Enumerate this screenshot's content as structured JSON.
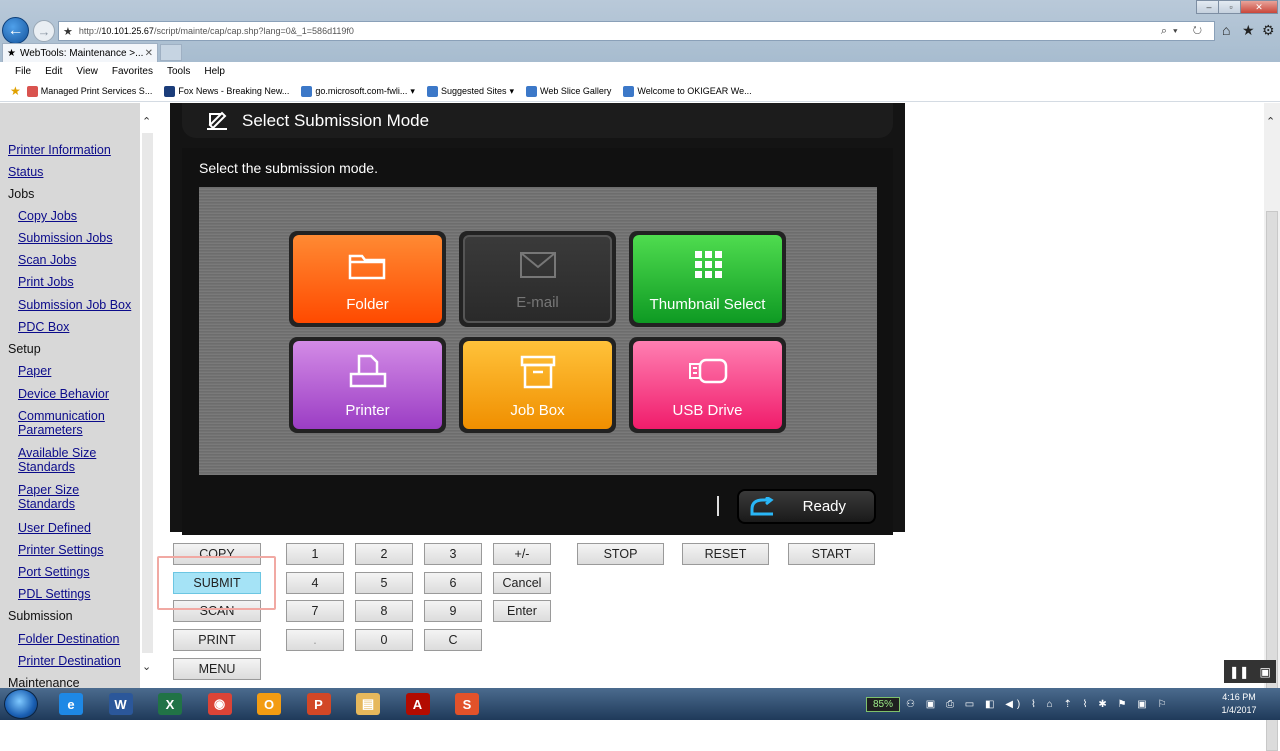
{
  "browser": {
    "url_prefix": "http://",
    "url_host": "10.101.25.67",
    "url_path": "/script/mainte/cap/cap.shp?lang=0&_1=586d119f0",
    "tab_title": "WebTools: Maintenance >...",
    "window_controls": [
      "–",
      "▫",
      "✕"
    ],
    "menu": [
      "File",
      "Edit",
      "View",
      "Favorites",
      "Tools",
      "Help"
    ],
    "favorites": [
      {
        "label": "Managed Print Services S...",
        "color": "#d9534f"
      },
      {
        "label": "Fox News - Breaking New...",
        "color": "#1b3d7a"
      },
      {
        "label": "go.microsoft.com-fwli...",
        "color": "#3c78c8"
      },
      {
        "label": "Suggested Sites",
        "color": "#3c78c8"
      },
      {
        "label": "Web Slice Gallery",
        "color": "#3c78c8"
      },
      {
        "label": "Welcome to OKIGEAR We...",
        "color": "#3c78c8"
      }
    ]
  },
  "nav": {
    "items": [
      {
        "label": "Printer Information",
        "type": "link",
        "indent": false
      },
      {
        "label": "Status",
        "type": "link",
        "indent": false
      },
      {
        "label": "Jobs",
        "type": "hdr",
        "indent": false
      },
      {
        "label": "Copy Jobs",
        "type": "link",
        "indent": true
      },
      {
        "label": "Submission Jobs",
        "type": "link",
        "indent": true
      },
      {
        "label": "Scan Jobs",
        "type": "link",
        "indent": true
      },
      {
        "label": "Print Jobs",
        "type": "link",
        "indent": true
      },
      {
        "label": "Submission Job Box",
        "type": "link",
        "indent": true
      },
      {
        "label": "PDC Box",
        "type": "link",
        "indent": true
      },
      {
        "label": "Setup",
        "type": "hdr",
        "indent": false
      },
      {
        "label": "Paper",
        "type": "link",
        "indent": true
      },
      {
        "label": "Device Behavior",
        "type": "link",
        "indent": true
      },
      {
        "label": "Communication Parameters",
        "type": "link",
        "indent": true
      },
      {
        "label": "Available Size Standards",
        "type": "link",
        "indent": true
      },
      {
        "label": "Paper Size Standards",
        "type": "link",
        "indent": true
      },
      {
        "label": "User Defined",
        "type": "link",
        "indent": true
      },
      {
        "label": "Printer Settings",
        "type": "link",
        "indent": true
      },
      {
        "label": "Port Settings",
        "type": "link",
        "indent": true
      },
      {
        "label": "PDL Settings",
        "type": "link",
        "indent": true
      },
      {
        "label": "Submission",
        "type": "hdr",
        "indent": false
      },
      {
        "label": "Folder Destination",
        "type": "link",
        "indent": true
      },
      {
        "label": "Printer Destination",
        "type": "link",
        "indent": true
      },
      {
        "label": "Maintenance",
        "type": "hdr",
        "indent": false
      }
    ]
  },
  "panel": {
    "title": "Select Submission Mode",
    "prompt": "Select the submission mode.",
    "tiles": [
      {
        "label": "Folder",
        "icon": "folder-icon",
        "colors": [
          "#ff8a33",
          "#ff4a00"
        ],
        "disabled": false
      },
      {
        "label": "E-mail",
        "icon": "envelope-icon",
        "colors": [
          "#3a3a3a",
          "#2a2a2a"
        ],
        "disabled": true
      },
      {
        "label": "Thumbnail Select",
        "icon": "grid-icon",
        "colors": [
          "#4fdc4f",
          "#0e9a23"
        ],
        "disabled": false
      },
      {
        "label": "Printer",
        "icon": "printer-icon",
        "colors": [
          "#d38be6",
          "#9b3dc4"
        ],
        "disabled": false
      },
      {
        "label": "Job Box",
        "icon": "archive-box-icon",
        "colors": [
          "#ffc23a",
          "#f08f00"
        ],
        "disabled": false
      },
      {
        "label": "USB Drive",
        "icon": "usb-drive-icon",
        "colors": [
          "#ff7fb2",
          "#f01c6b"
        ],
        "disabled": false
      }
    ],
    "status": "Ready"
  },
  "keys": {
    "mode": [
      "COPY",
      "SUBMIT",
      "SCAN",
      "PRINT",
      "MENU"
    ],
    "active_mode": "SUBMIT",
    "numpad": [
      "1",
      "2",
      "3",
      "+/-",
      "4",
      "5",
      "6",
      "Cancel",
      "7",
      "8",
      "9",
      "Enter",
      ".",
      "0",
      "C"
    ],
    "controls": [
      "STOP",
      "RESET",
      "START"
    ]
  },
  "taskbar": {
    "apps": [
      {
        "name": "ie-icon",
        "letter": "e",
        "color": "#1e88e5"
      },
      {
        "name": "word-icon",
        "letter": "W",
        "color": "#2b579a"
      },
      {
        "name": "excel-icon",
        "letter": "X",
        "color": "#217346"
      },
      {
        "name": "chrome-icon",
        "letter": "◉",
        "color": "#db4437"
      },
      {
        "name": "outlook-icon",
        "letter": "O",
        "color": "#f39c12"
      },
      {
        "name": "powerpoint-icon",
        "letter": "P",
        "color": "#d24726"
      },
      {
        "name": "file-explorer-icon",
        "letter": "▤",
        "color": "#e6b85c"
      },
      {
        "name": "acrobat-icon",
        "letter": "A",
        "color": "#b30b00"
      },
      {
        "name": "snagit-icon",
        "letter": "S",
        "color": "#e2522a"
      }
    ],
    "battery": "85%",
    "time": "4:16 PM",
    "date": "1/4/2017"
  }
}
